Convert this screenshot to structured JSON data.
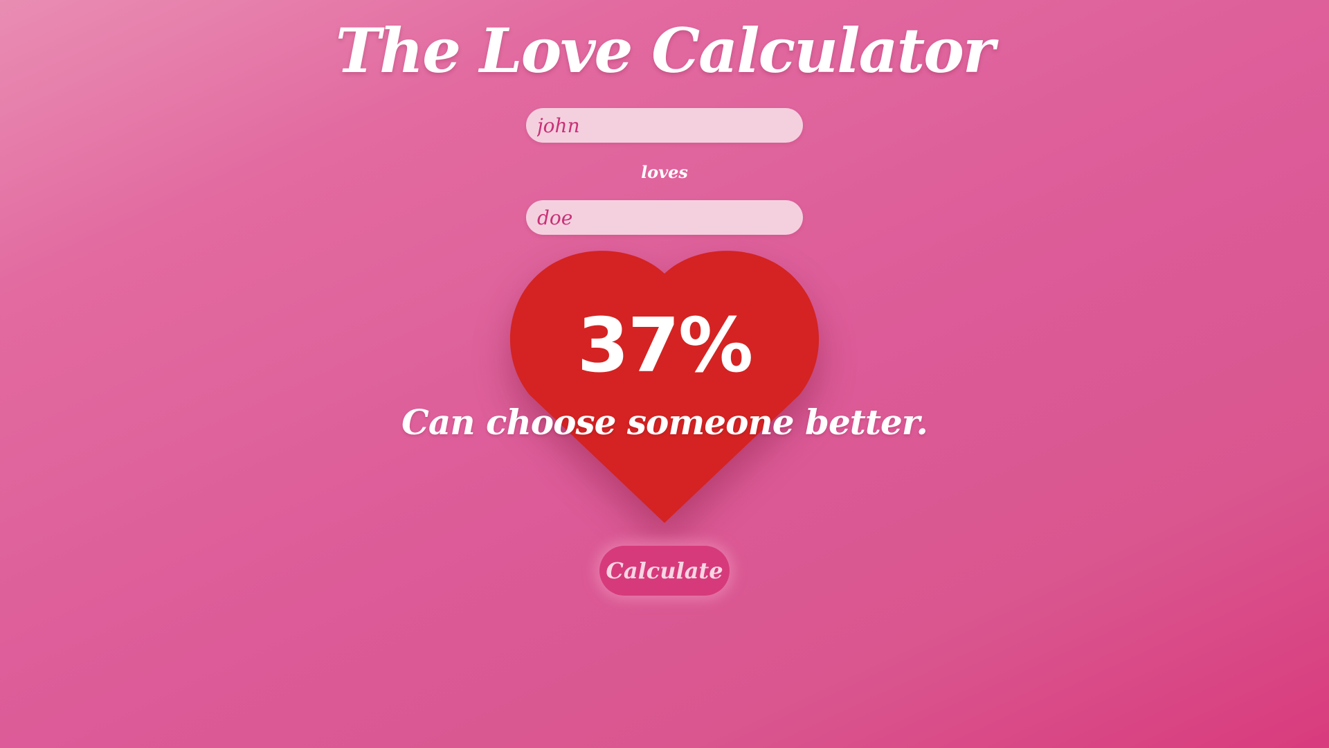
{
  "app": {
    "title": "The Love Calculator"
  },
  "form": {
    "first_name_value": "john",
    "connector_label": "loves",
    "second_name_value": "doe",
    "calculate_label": "Calculate"
  },
  "result": {
    "percentage_text": "37%",
    "percentage_value": 37,
    "message": "Can choose someone better."
  },
  "colors": {
    "background": "#dc5b98",
    "heart": "#d42322",
    "input_bg": "#f4d0df",
    "input_text": "#c93077",
    "button_bg": "#d63a7b",
    "button_text": "#f7d6e3"
  },
  "icons": {
    "heart": "heart-icon"
  }
}
